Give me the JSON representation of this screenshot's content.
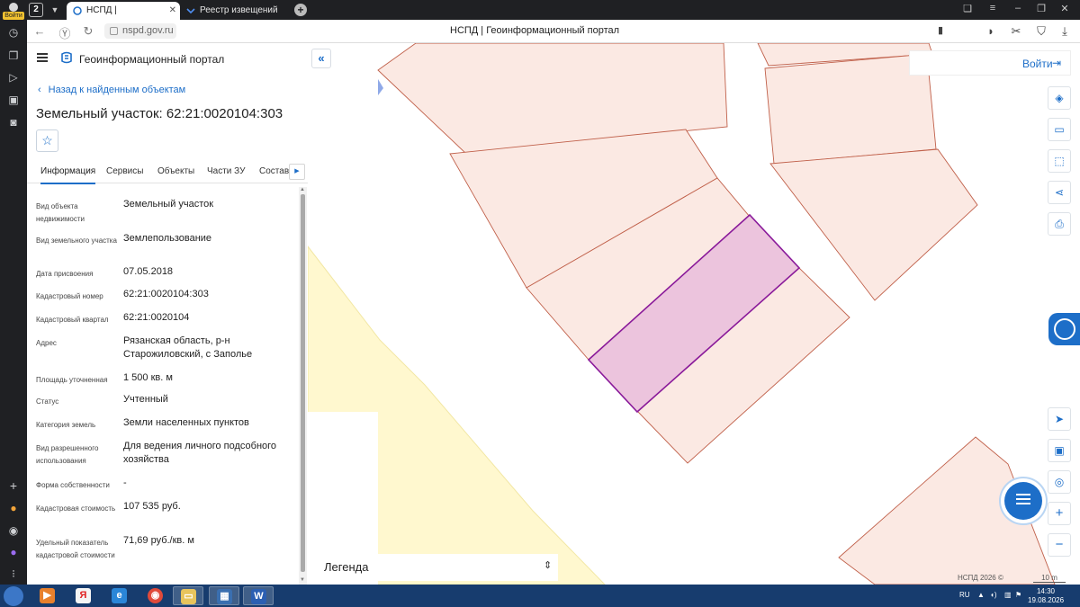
{
  "browser": {
    "login_badge": "Войти",
    "tab_count": "2",
    "tabs": [
      {
        "label": "НСПД | Геоинформаци"
      },
      {
        "label": "Реестр извещений"
      }
    ],
    "url": "nspd.gov.ru",
    "page_title": "НСПД | Геоинформационный портал"
  },
  "app": {
    "title": "Геоинформационный портал",
    "back_label": "Назад к найденным объектам",
    "object_title": "Земельный участок: 62:21:0020104:303",
    "tabs": [
      "Информация",
      "Сервисы",
      "Объекты",
      "Части ЗУ",
      "Состав"
    ],
    "properties": [
      {
        "label": "Вид объекта недвижимости",
        "value": "Земельный участок"
      },
      {
        "label": "Вид земельного участка",
        "value": "Землепользование"
      },
      {
        "label": "Дата присвоения",
        "value": "07.05.2018"
      },
      {
        "label": "Кадастровый номер",
        "value": "62:21:0020104:303"
      },
      {
        "label": "Кадастровый квартал",
        "value": "62:21:0020104"
      },
      {
        "label": "Адрес",
        "value": "Рязанская область, р-н Старожиловский, с Заполье"
      },
      {
        "label": "Площадь уточненная",
        "value": "1 500 кв. м"
      },
      {
        "label": "Статус",
        "value": "Учтенный"
      },
      {
        "label": "Категория земель",
        "value": "Земли населенных пунктов"
      },
      {
        "label": "Вид разрешенного использования",
        "value": "Для ведения личного подсобного хозяйства"
      },
      {
        "label": "Форма собственности",
        "value": "-"
      },
      {
        "label": "Кадастровая стоимость",
        "value": "107 535 руб."
      },
      {
        "label": "Удельный показатель кадастровой стоимости",
        "value": "71,69 руб./кв. м"
      }
    ]
  },
  "map": {
    "login_label": "Войти",
    "legend_label": "Легенда",
    "copyright": "НСПД 2026 ©",
    "scale_label": "10 m",
    "colors": {
      "parcel_fill": "#fbe9e3",
      "parcel_stroke": "#c0604a",
      "selected_fill": "#ecc4dd",
      "selected_stroke": "#8a1a9a",
      "zone_fill": "#fff8cf",
      "accent": "#1d6ec8"
    }
  },
  "taskbar": {
    "lang": "RU",
    "time": "14:30",
    "date": "19.08.2026"
  }
}
